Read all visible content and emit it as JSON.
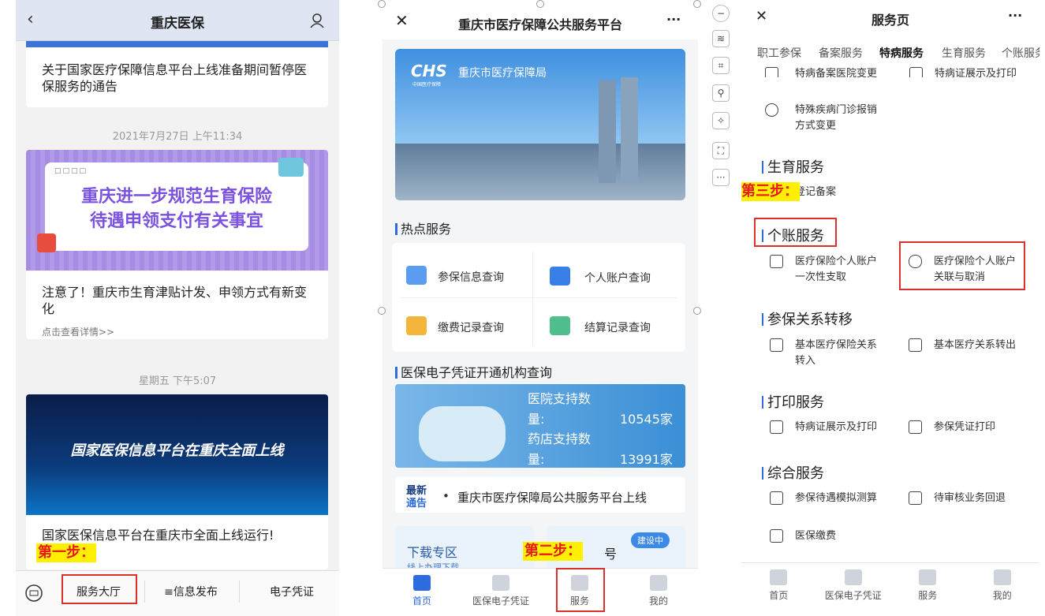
{
  "panel1": {
    "title": "重庆医保",
    "notice": "关于国家医疗保障信息平台上线准备期间暂停医保服务的通告",
    "ts1": "2021年7月27日 上午11:34",
    "banner1_line1": "重庆进一步规范生育保险",
    "banner1_line2": "待遇申领支付有关事宜",
    "article1": "注意了！重庆市生育津贴计发、申领方式有新变化",
    "detail": "点击查看详情>>",
    "ts2": "星期五 下午5:07",
    "banner2": "国家医保信息平台在重庆全面上线",
    "article2": "国家医保信息平台在重庆市全面上线运行!",
    "step": "第一步：",
    "menu": [
      "服务大厅",
      "≡信息发布",
      "电子凭证"
    ]
  },
  "panel2": {
    "title": "重庆市医疗保障公共服务平台",
    "more": "···",
    "logo": "CHS",
    "logo_sub": "中国医疗保障",
    "bureau": "重庆市医疗保障局",
    "hot_title": "热点服务",
    "services": [
      {
        "label": "参保信息查询",
        "color": "#5a9cf2"
      },
      {
        "label": "个人账户查询",
        "color": "#3a7ee8"
      },
      {
        "label": "缴费记录查询",
        "color": "#f3b53a"
      },
      {
        "label": "结算记录查询",
        "color": "#4fc08d"
      }
    ],
    "voucher_title": "医保电子凭证开通机构查询",
    "hosp_label1": "医院支持数",
    "hosp_label2": "量:",
    "hosp_value": "10545家",
    "pharm_label1": "药店支持数",
    "pharm_label2": "量:",
    "pharm_value": "13991家",
    "news_tag1": "最新",
    "news_tag2": "通告",
    "news": "重庆市医疗保障局公共服务平台上线",
    "download": "下载专区",
    "download_sub": "线上办理下载",
    "building": "建设中",
    "step": "第二步：",
    "hao": "号",
    "tabs": [
      "首页",
      "医保电子凭证",
      "服务",
      "我的"
    ]
  },
  "panel3": {
    "title": "服务页",
    "more": "···",
    "tabs": [
      "职工参保",
      "备案服务",
      "特病服务",
      "生育服务",
      "个账服务"
    ],
    "top_items": [
      "特病备案医院变更",
      "特病证展示及打印"
    ],
    "special_item_l1": "特殊疾病门诊报销",
    "special_item_l2": "方式变更",
    "sec_birth": "生育服务",
    "birth_item": "登记备案",
    "step": "第三步：",
    "sec_account": "个账服务",
    "acc_item1_l1": "医疗保险个人账户",
    "acc_item1_l2": "一次性支取",
    "acc_item2_l1": "医疗保险个人账户",
    "acc_item2_l2": "关联与取消",
    "sec_transfer": "参保关系转移",
    "tr_item1_l1": "基本医疗保险关系",
    "tr_item1_l2": "转入",
    "tr_item2": "基本医疗关系转出",
    "sec_print": "打印服务",
    "pr_item1": "特病证展示及打印",
    "pr_item2": "参保凭证打印",
    "sec_general": "综合服务",
    "gen_item1": "参保待遇模拟测算",
    "gen_item2": "待审核业务回退",
    "gen_item3": "医保缴费",
    "bottom": [
      "首页",
      "医保电子凭证",
      "服务",
      "我的"
    ]
  }
}
